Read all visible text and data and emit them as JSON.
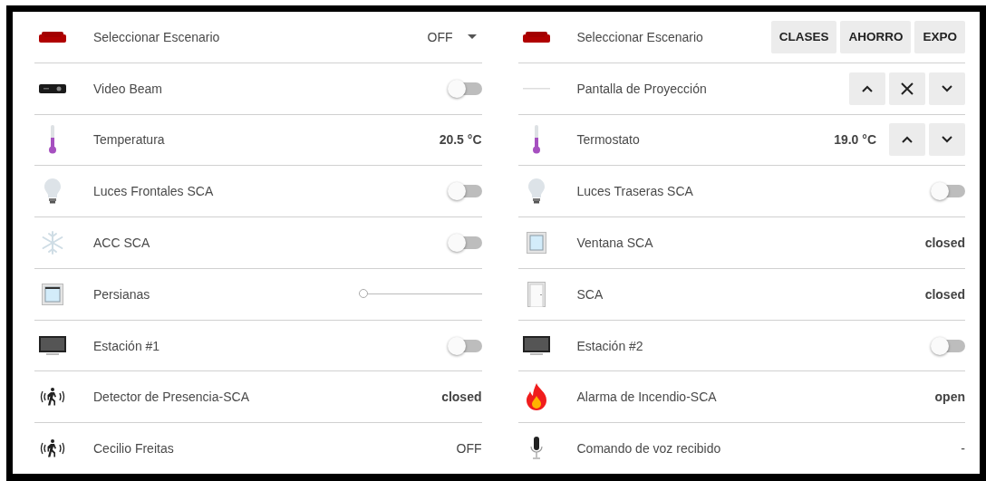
{
  "columns": [
    {
      "rows": [
        {
          "kind": "select",
          "label": "Seleccionar Escenario",
          "value": "OFF"
        },
        {
          "kind": "toggle",
          "label": "Video Beam",
          "on": false
        },
        {
          "kind": "sensor",
          "label": "Temperatura",
          "value": "20.5 °C"
        },
        {
          "kind": "toggle",
          "label": "Luces Frontales SCA",
          "on": false
        },
        {
          "kind": "toggle",
          "label": "ACC SCA",
          "on": false
        },
        {
          "kind": "slider",
          "label": "Persianas",
          "level": 0
        },
        {
          "kind": "toggle",
          "label": "Estación #1",
          "on": false
        },
        {
          "kind": "sensor",
          "label": "Detector de Presencia-SCA",
          "value": "closed"
        },
        {
          "kind": "text",
          "label": "Cecilio Freitas",
          "value": "OFF"
        }
      ]
    },
    {
      "rows": [
        {
          "kind": "buttons",
          "label": "Seleccionar Escenario",
          "buttons": [
            "CLASES",
            "AHORRO",
            "EXPO"
          ]
        },
        {
          "kind": "cover",
          "label": "Pantalla de Proyección"
        },
        {
          "kind": "climate",
          "label": "Termostato",
          "value": "19.0 °C"
        },
        {
          "kind": "toggle",
          "label": "Luces Traseras SCA",
          "on": false
        },
        {
          "kind": "sensor",
          "label": "Ventana SCA",
          "value": "closed"
        },
        {
          "kind": "sensor",
          "label": "SCA",
          "value": "closed"
        },
        {
          "kind": "toggle",
          "label": "Estación #2",
          "on": false
        },
        {
          "kind": "sensor",
          "label": "Alarma de Incendio-SCA",
          "value": "open"
        },
        {
          "kind": "text",
          "label": "Comando de voz recibido",
          "value": "-"
        }
      ]
    }
  ]
}
